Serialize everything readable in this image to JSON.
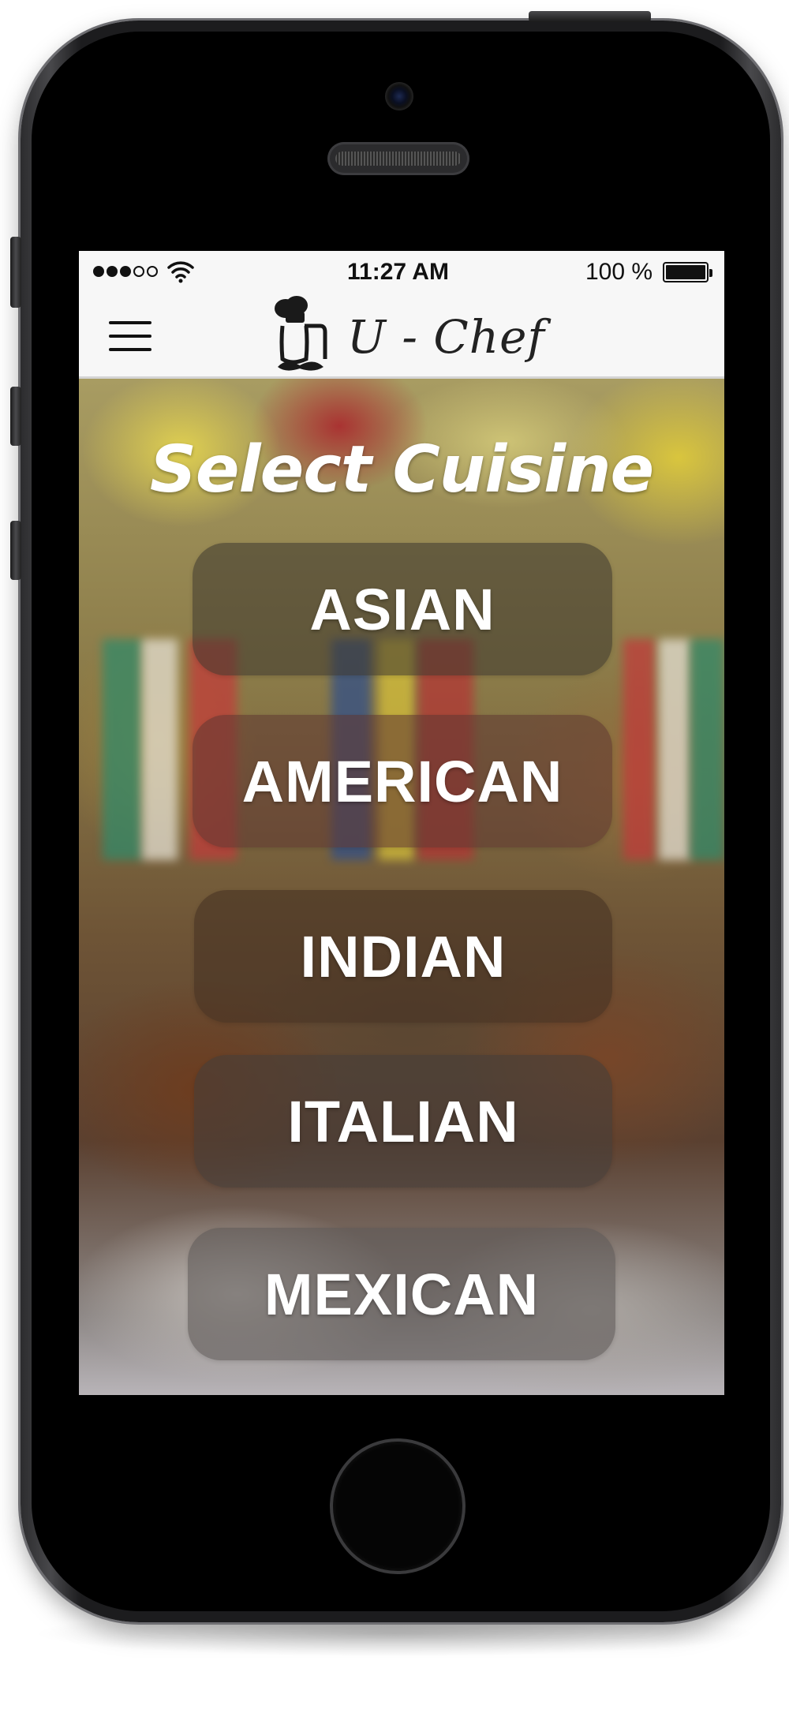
{
  "status_bar": {
    "time": "11:27 AM",
    "battery": "100 %"
  },
  "app": {
    "name": "U - Chef"
  },
  "page": {
    "title": "Select Cuisine"
  },
  "cuisines": [
    {
      "label": "ASIAN"
    },
    {
      "label": "AMERICAN"
    },
    {
      "label": "INDIAN"
    },
    {
      "label": "ITALIAN"
    },
    {
      "label": "MEXICAN"
    }
  ],
  "colors": {
    "text_on_image": "#ffffff",
    "nav_background": "#f7f7f7",
    "button_fill": "rgba(80,70,55,0.55)"
  },
  "icons": [
    "menu-icon",
    "chef-logo-icon",
    "wifi-icon",
    "battery-icon",
    "signal-icon"
  ]
}
